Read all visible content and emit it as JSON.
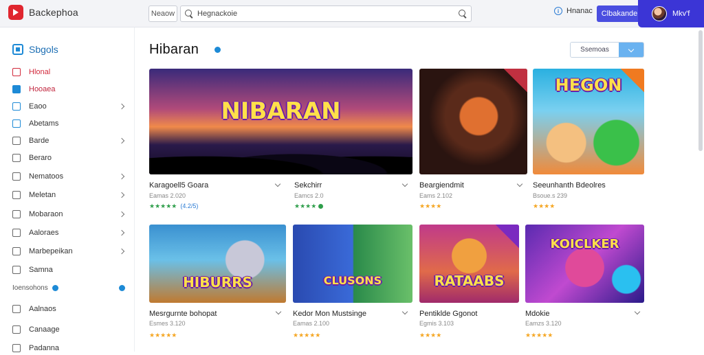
{
  "app": {
    "logo_text": "Backephoa"
  },
  "topbar": {
    "scope_label": "Neaow",
    "search_placeholder": "Hegnackoie",
    "user_label": "Hnanac",
    "primary_button": "Clbakande",
    "profile_name": "Mkv'f"
  },
  "sidebar": {
    "header": "Sbgols",
    "items": [
      {
        "label": "Hlonal"
      },
      {
        "label": "Hooaea"
      },
      {
        "label": "Eaoo"
      },
      {
        "label": "Abetams"
      },
      {
        "label": "Barde"
      },
      {
        "label": "Beraro"
      },
      {
        "label": "Nematoos"
      },
      {
        "label": "Meletan"
      },
      {
        "label": "Mobaraon"
      },
      {
        "label": "Aaloraes"
      },
      {
        "label": "Marbepeikan"
      },
      {
        "label": "Samna"
      }
    ],
    "section_label": "Ioensohons",
    "bottom_items": [
      {
        "label": "Aalnaos"
      },
      {
        "label": "Canaage"
      },
      {
        "label": "Padanna"
      }
    ]
  },
  "main": {
    "title": "Hibaran",
    "filter_label": "Ssemoas",
    "cards": [
      {
        "title": "Karagoell5 Goara",
        "subtitle": "Eamas 2.020",
        "stars": "★★★★★",
        "reviews": "(4.2/5)",
        "art": "NIBARAN"
      },
      {
        "title": "Sekchirr",
        "subtitle": "Eamcs 2.0",
        "stars": "★★★★",
        "art": ""
      },
      {
        "title": "Beargiendmit",
        "subtitle": "Eams 2.102",
        "stars": "★★★★",
        "art": ""
      },
      {
        "title": "Seeunhanth Bdeolres",
        "subtitle": "Bsoue.s 239",
        "stars": "★★★★",
        "art": "HEGON"
      },
      {
        "title": "Mesrgurnte bohopat",
        "subtitle": "Esmes 3.120",
        "stars": "★★★★★",
        "art": "HIBURRS"
      },
      {
        "title": "Kedor Mon Mustsinge",
        "subtitle": "Eamas 2.100",
        "stars": "★★★★★",
        "art": "CLUSONS"
      },
      {
        "title": "Pentiklde Ggonot",
        "subtitle": "Egmis 3.103",
        "stars": "★★★★",
        "art": "RATAABS"
      },
      {
        "title": "Mdokie",
        "subtitle": "Eamzs 3.120",
        "stars": "★★★★★",
        "art": "KOICLKER"
      }
    ]
  },
  "colors": {
    "accent": "#4a4ee0",
    "profile_bg": "#3b35d6",
    "link_blue": "#1d8ad6",
    "active_red": "#d1283a",
    "star_gold": "#f5a623",
    "star_green": "#2e9e4a"
  },
  "icons": [
    "logo-play-icon",
    "search-icon",
    "info-icon",
    "chevron-right-icon",
    "chevron-down-icon",
    "star-icon"
  ]
}
